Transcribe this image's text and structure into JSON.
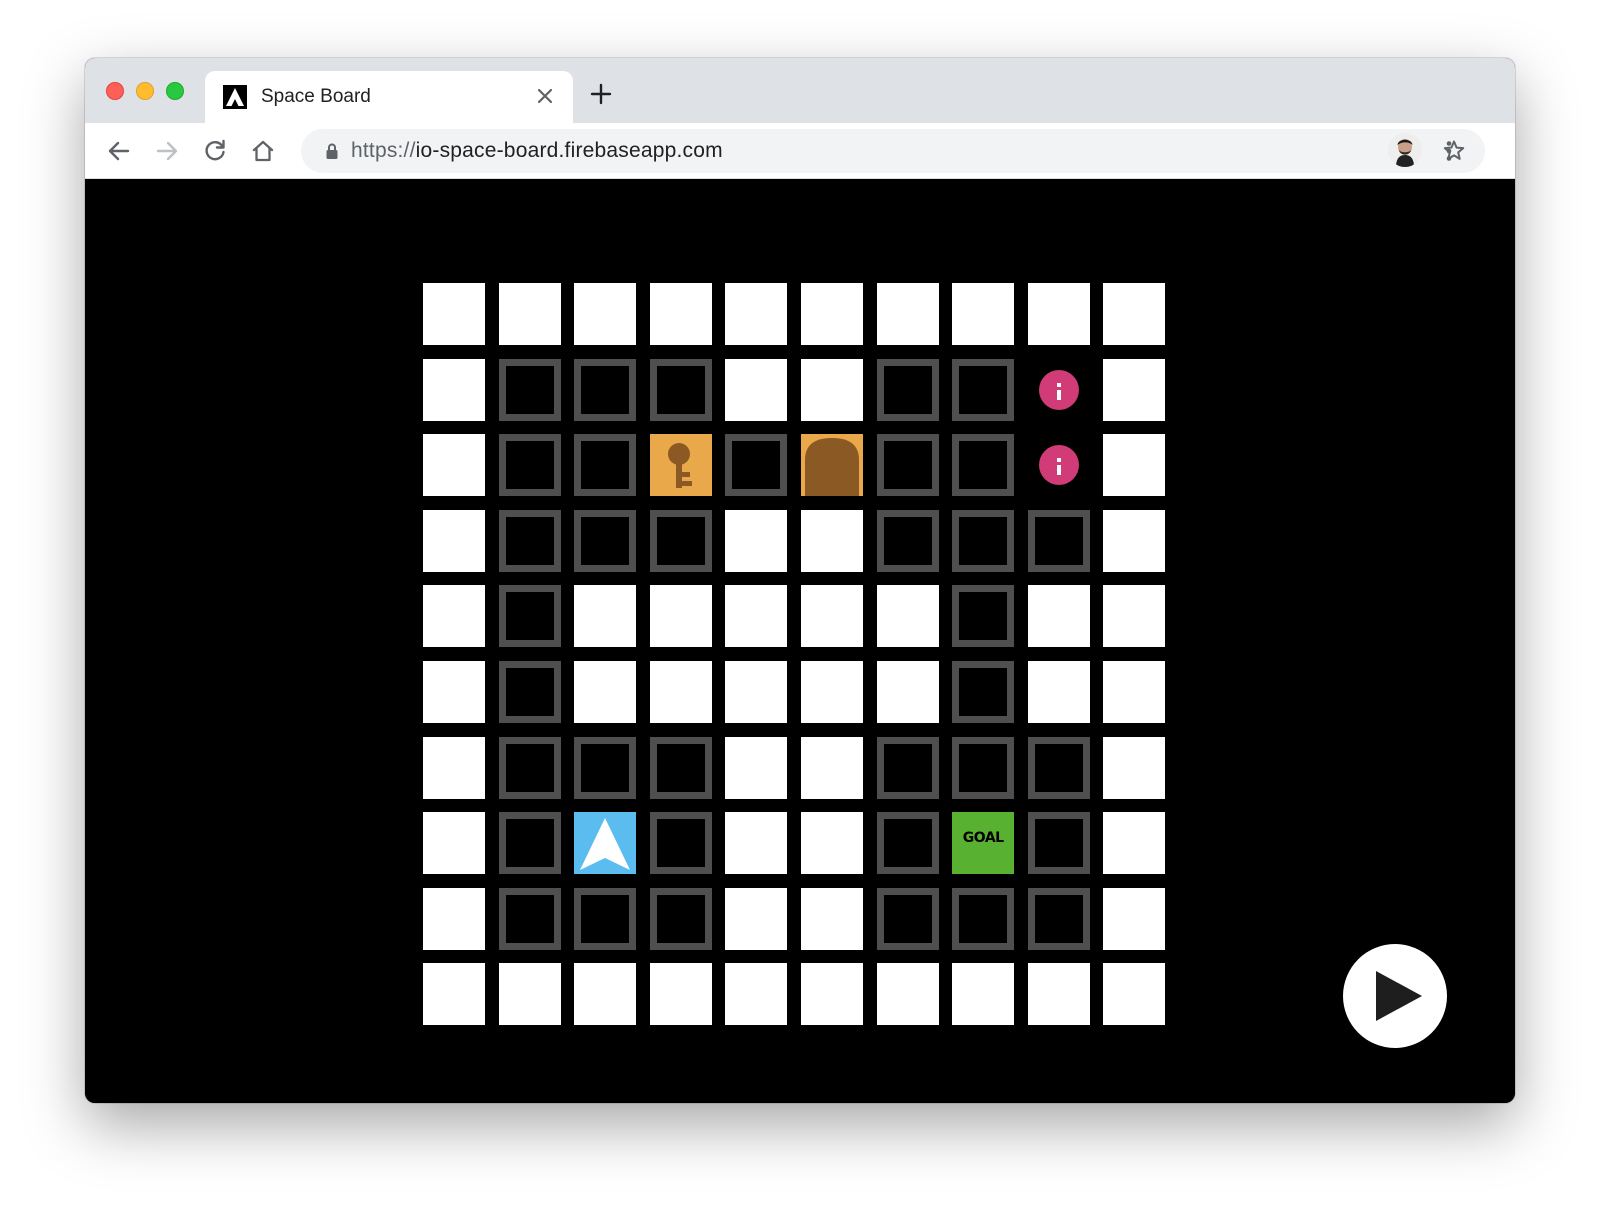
{
  "browser": {
    "tab_title": "Space Board",
    "url_scheme": "https://",
    "url_host": "io-space-board.firebaseapp.com"
  },
  "colors": {
    "path": "#ffffff",
    "wall_border": "#4f4f4f",
    "background": "#000000",
    "key_door": "#e9a94a",
    "door_arch": "#8b5a24",
    "player": "#5bbcf0",
    "goal": "#58b131",
    "info": "#d13b78"
  },
  "board": {
    "size": 10,
    "legend": {
      ".": "path",
      "#": "wall",
      "K": "key",
      "D": "door",
      "P": "player",
      "G": "goal",
      "I": "info"
    },
    "rows": [
      "..........",
      ".###..##I.",
      ".##K#D##I.",
      ".###..###.",
      ".#.....#..",
      ".#.....#..",
      ".###..###.",
      ".#P#..#G#.",
      ".###..###.",
      ".........."
    ],
    "goal_label": "GOAL"
  },
  "controls": {
    "play_icon": "play-icon"
  }
}
